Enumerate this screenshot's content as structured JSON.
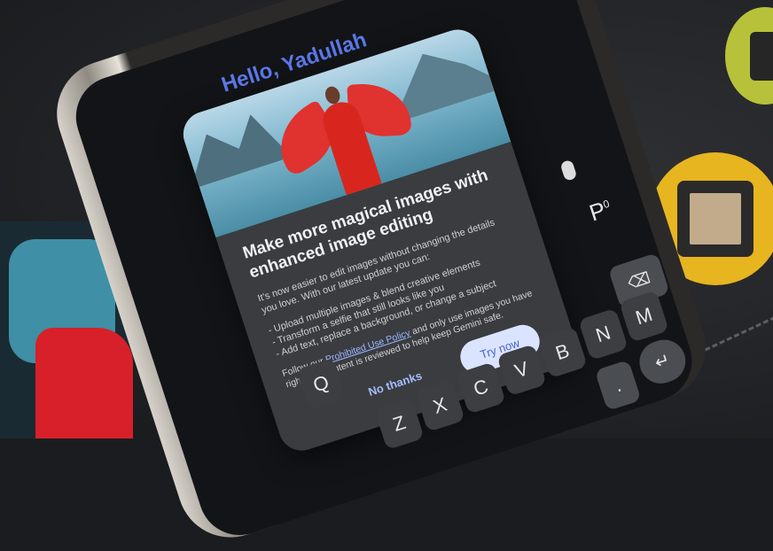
{
  "greeting": "Hello, Yadullah",
  "dialog": {
    "title": "Make more magical images with enhanced image editing",
    "intro": "It's now easier to edit images without changing the details you love. With our latest update you can:",
    "bullets": [
      "- Upload multiple images & blend creative elements",
      "- Transform a selfie that still looks like you",
      "- Add text, replace a background, or change a subject"
    ],
    "footer_pre": "Follow our ",
    "footer_link": "Prohibited Use Policy",
    "footer_post": " and only use images you have rights to. Content is reviewed to help keep Gemini safe.",
    "no_label": "No thanks",
    "try_label": "Try now"
  },
  "keyboard": {
    "row_top_letter": "P",
    "row_top_super": "0",
    "q": "Q",
    "row_bottom": [
      "Z",
      "X",
      "C",
      "V",
      "B",
      "N",
      "M"
    ],
    "backspace": "⌫",
    "enter": "↵",
    "dot": "."
  },
  "icons": [
    "mic-icon",
    "apps-grid-icon",
    "backspace-icon",
    "enter-icon"
  ],
  "colors": {
    "accent": "#5b78e8",
    "button": "#dbe4ff",
    "dialog": "#3a3c40"
  }
}
